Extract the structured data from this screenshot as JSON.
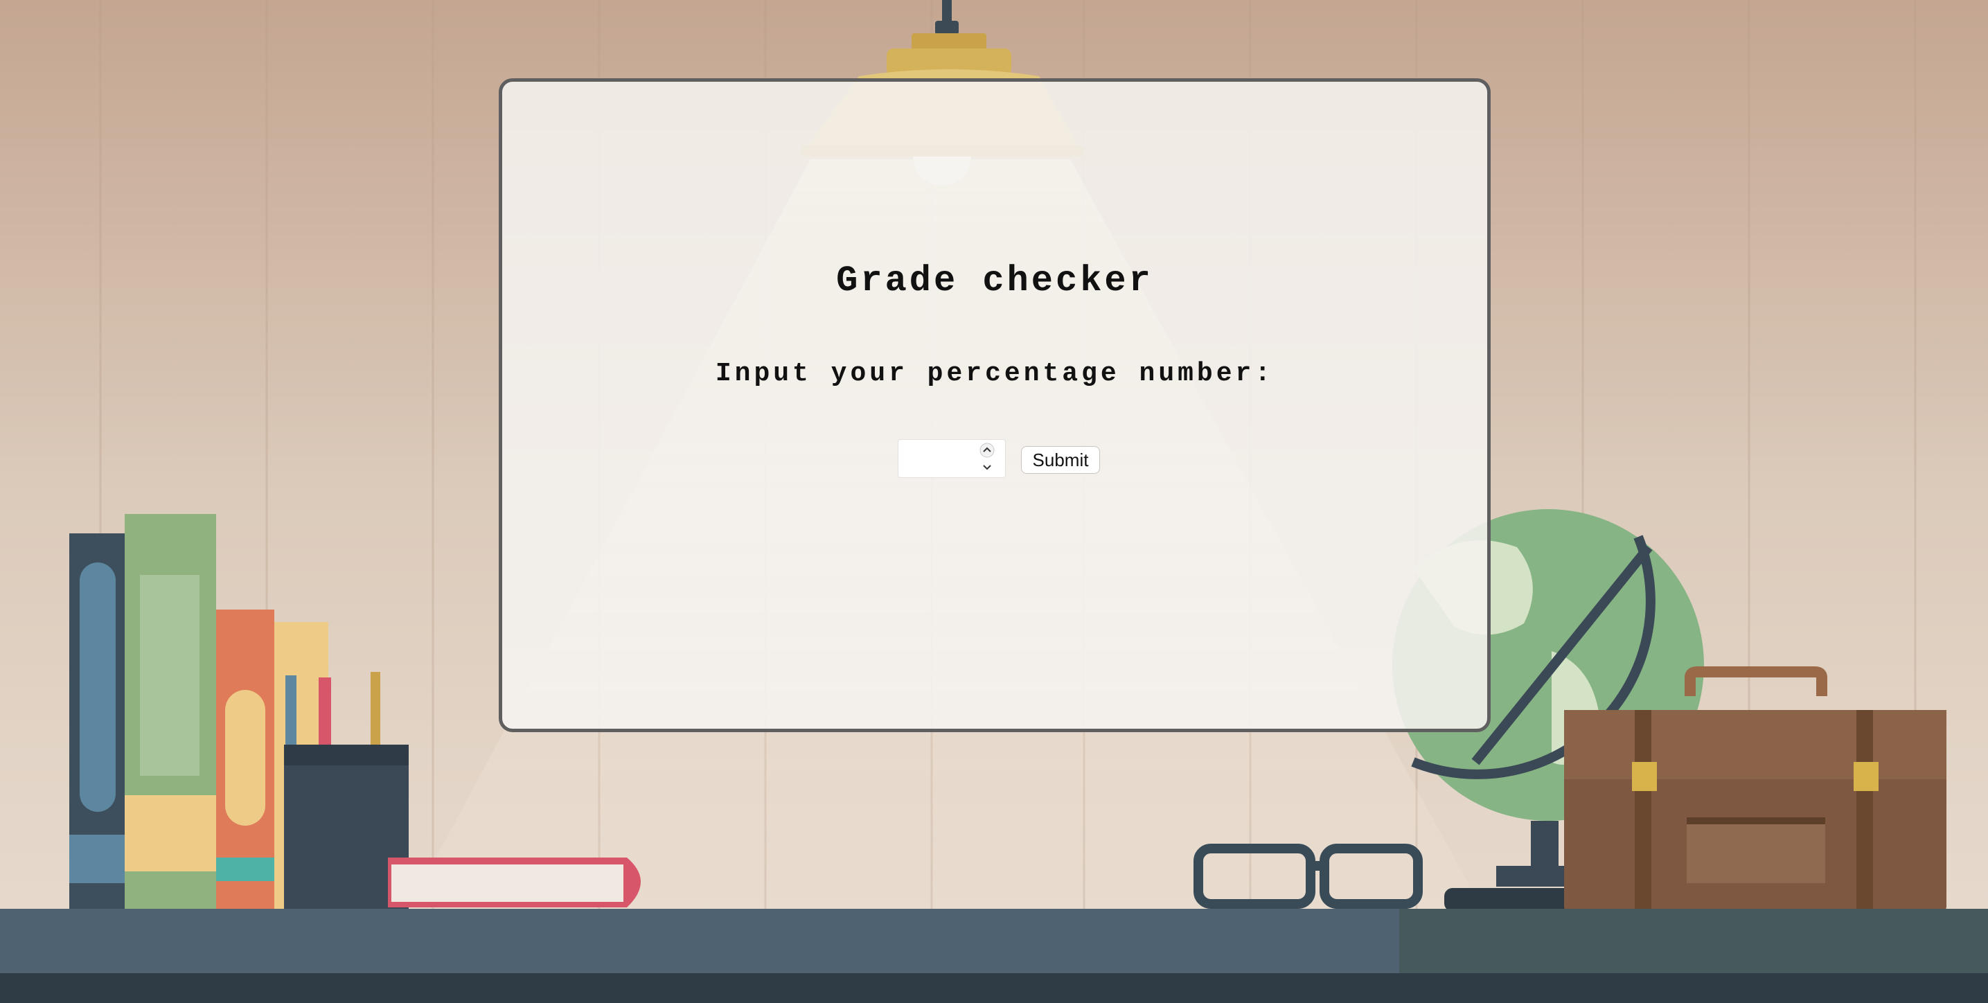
{
  "page": {
    "title": "Grade checker",
    "prompt": "Input your percentage number:"
  },
  "form": {
    "input_value": "",
    "submit_label": "Submit"
  },
  "icons": {
    "step_up": "chevron-up-icon",
    "step_down": "chevron-down-icon"
  },
  "colors": {
    "wall_top": "#c4a691",
    "wall_bottom": "#e6d9cc",
    "desk": "#4e6271",
    "card_border": "#5f5f5f",
    "card_fill": "#f5f2ef"
  }
}
